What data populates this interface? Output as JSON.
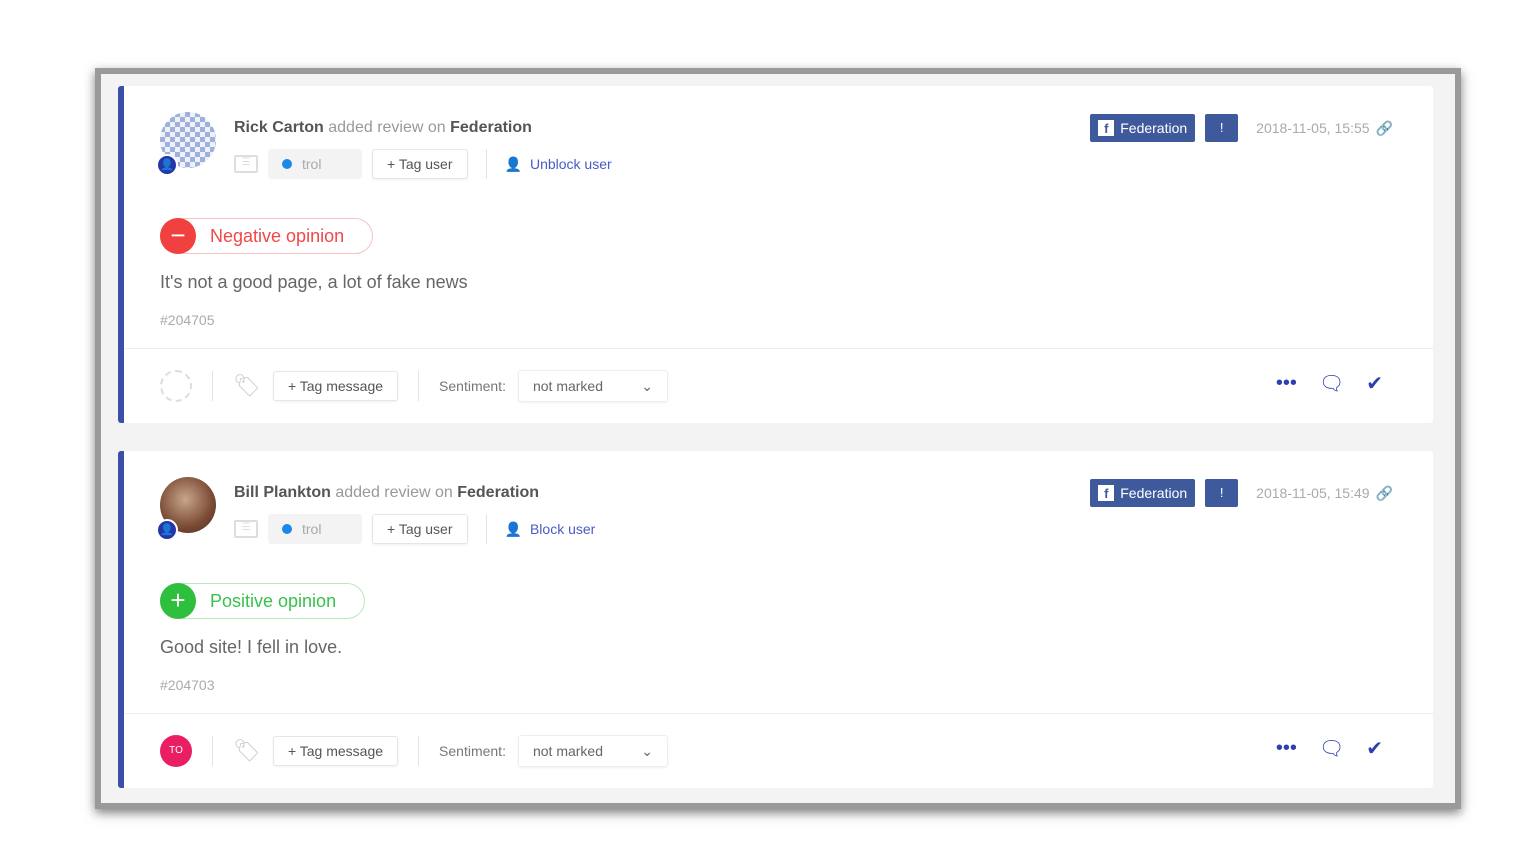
{
  "reviews": [
    {
      "user": "Rick Carton",
      "action": "added review on",
      "target": "Federation",
      "label": "trol",
      "tag_user": "+ Tag user",
      "block_action": "Unblock user",
      "source": "Federation",
      "date": "2018-11-05, 15:55",
      "opinion": "Negative opinion",
      "text": "It's not a good page, a lot of fake news",
      "id": "#204705",
      "assignee": "",
      "tag_message": "+ Tag message",
      "sentiment_label": "Sentiment:",
      "sentiment_value": "not marked"
    },
    {
      "user": "Bill Plankton",
      "action": "added review on",
      "target": "Federation",
      "label": "trol",
      "tag_user": "+ Tag user",
      "block_action": "Block user",
      "source": "Federation",
      "date": "2018-11-05, 15:49",
      "opinion": "Positive opinion",
      "text": "Good site! I fell in love.",
      "id": "#204703",
      "assignee": "TO",
      "tag_message": "+ Tag message",
      "sentiment_label": "Sentiment:",
      "sentiment_value": "not marked"
    }
  ],
  "colors": {
    "accent": "#3a4fa8",
    "negative": "#f04040",
    "positive": "#2fbf3f",
    "facebook": "#3f5a9c"
  }
}
